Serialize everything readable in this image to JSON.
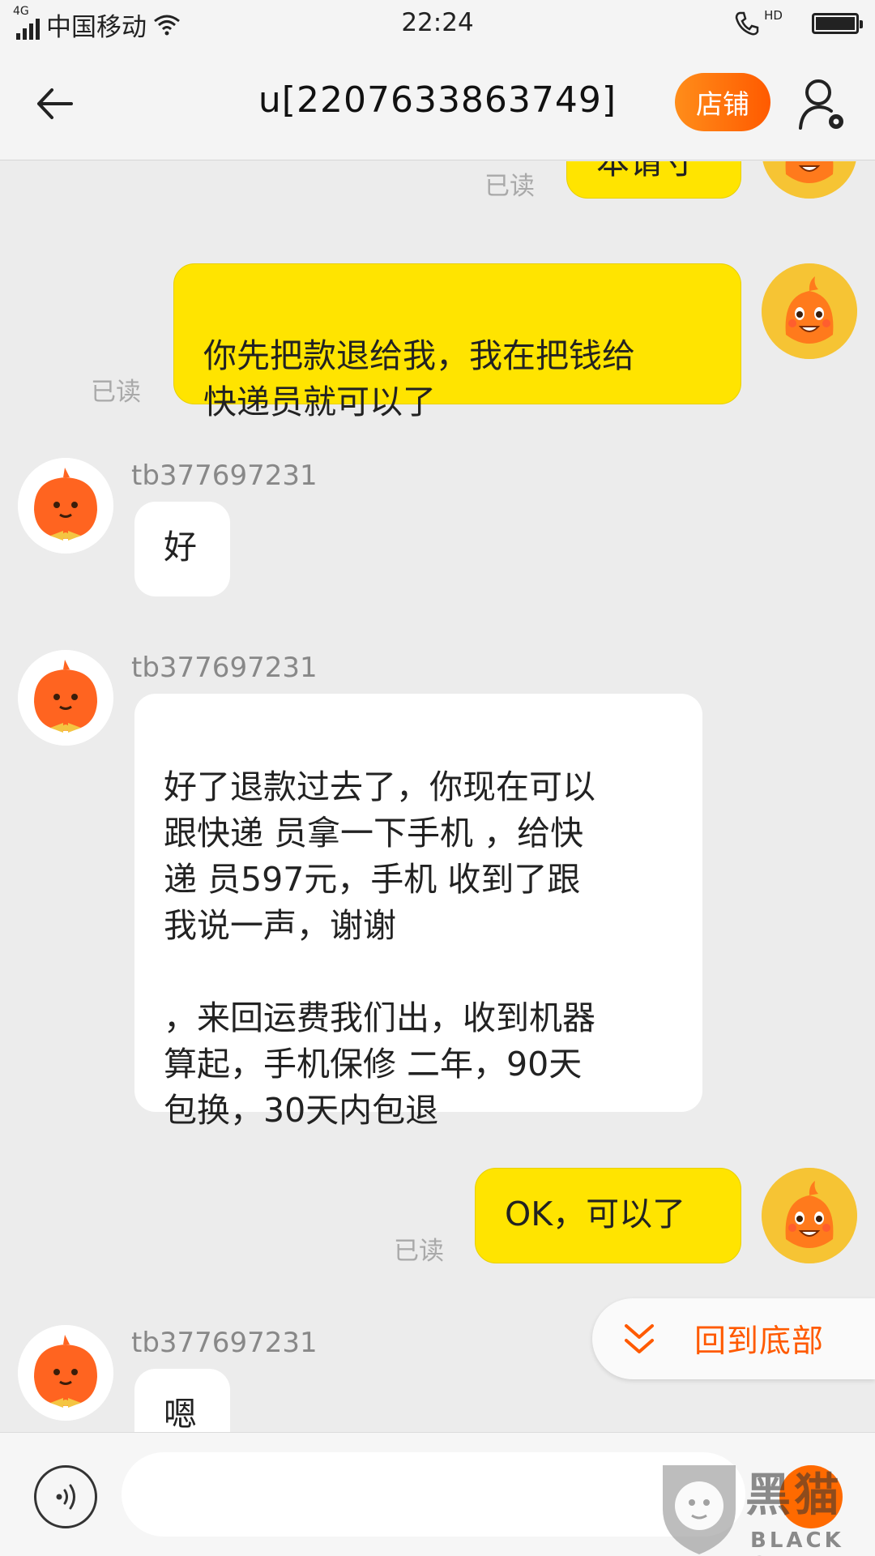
{
  "status_bar": {
    "network": "4G",
    "carrier": "中国移动",
    "time": "22:24",
    "hd": "HD"
  },
  "header": {
    "title": "u[2207633863749]",
    "store_label": "店铺"
  },
  "chat": {
    "partial_bubble_text": "本请寸",
    "messages": [
      {
        "from": "me",
        "text": "你先把款退给我，我在把钱给\n快递员就可以了",
        "status": "已读"
      },
      {
        "from": "them",
        "sender": "tb377697231",
        "text": "好"
      },
      {
        "from": "them",
        "sender": "tb377697231",
        "text": "好了退款过去了，你现在可以\n跟快递 员拿一下手机 ，给快\n递 员597元，手机 收到了跟\n我说一声，谢谢\n\n，来回运费我们出，收到机器\n算起，手机保修 二年，90天\n包换，30天内包退"
      },
      {
        "from": "me",
        "text": "OK，可以了",
        "status": "已读"
      },
      {
        "from": "them",
        "sender": "tb377697231",
        "text": "嗯"
      }
    ],
    "partial_read": "已读"
  },
  "back_to_bottom": {
    "label": "回到底部"
  },
  "input_bar": {
    "placeholder": ""
  },
  "watermark": {
    "text": "黑猫",
    "sub": "BLACK CAT"
  },
  "colors": {
    "accent": "#ff5a00",
    "bubble_me": "#ffe400",
    "bubble_them": "#ffffff",
    "background": "#ececec"
  }
}
